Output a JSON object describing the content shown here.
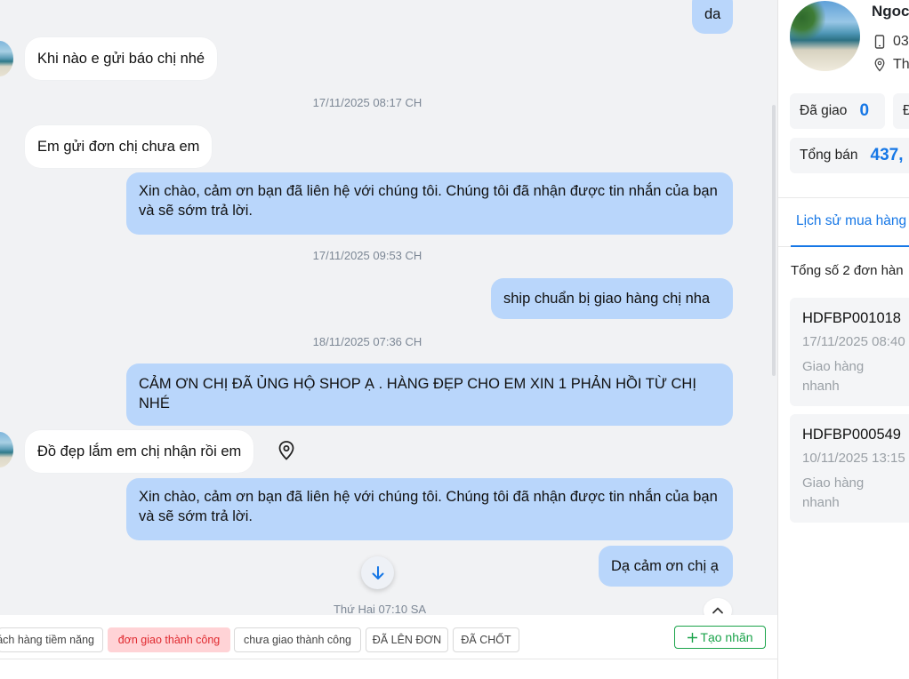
{
  "chat": {
    "messages": [
      {
        "text": "da"
      },
      {
        "text": "Khi nào e gửi báo chị nhé"
      },
      {
        "text": "17/11/2025 08:17 CH"
      },
      {
        "text": "Em gửi đơn chị chưa em"
      },
      {
        "text": "Xin chào, cảm ơn bạn đã liên hệ với chúng tôi. Chúng tôi đã nhận được tin nhắn của bạn và sẽ sớm trả lời."
      },
      {
        "text": "17/11/2025 09:53 CH"
      },
      {
        "text": "ship chuẩn bị giao hàng chị nha"
      },
      {
        "text": "18/11/2025 07:36 CH"
      },
      {
        "text": "CẢM ƠN CHỊ ĐÃ ỦNG HỘ SHOP Ạ . HÀNG ĐẸP CHO EM XIN 1 PHẢN HỒI TỪ CHỊ NHÉ"
      },
      {
        "text": "Đồ đẹp lắm em chị nhận rồi em"
      },
      {
        "text": "Xin chào, cảm ơn bạn đã liên hệ với chúng tôi. Chúng tôi đã nhận được tin nhắn của bạn và sẽ sớm trả lời."
      },
      {
        "text": "Dạ cảm ơn chị ạ"
      },
      {
        "text": "Thứ Hai 07:10 SA"
      }
    ]
  },
  "tags": {
    "items": [
      {
        "label": "ách hàng tiềm năng"
      },
      {
        "label": "đơn giao thành công",
        "color": "#e0292f"
      },
      {
        "label": "chưa giao thành công"
      },
      {
        "label": "ĐÃ LÊN ĐƠN"
      },
      {
        "label": "ĐÃ CHỐT"
      }
    ],
    "create_label": "Tạo nhãn",
    "create_color": "#1aa34a"
  },
  "customer": {
    "name": "Ngoc",
    "phone": "03",
    "address": "Th",
    "stats": {
      "delivered_label": "Đã giao",
      "delivered_value": "0",
      "next_label": "Đ",
      "total_label": "Tổng bán",
      "total_value": "437,"
    }
  },
  "history": {
    "tab_label": "Lịch sử mua hàng",
    "count_prefix": "Tổng số ",
    "count_value": "2",
    "count_suffix": " đơn hàn",
    "orders": [
      {
        "code": "HDFBP001018",
        "date": "17/11/2025 08:40",
        "ship": "Giao hàng nhanh"
      },
      {
        "code": "HDFBP000549",
        "date": "10/11/2025 13:15",
        "ship": "Giao hàng nhanh"
      }
    ]
  },
  "colors": {
    "accent": "#1677e6",
    "bubble_out": "#b9d6fb",
    "chat_bg": "#f1f2f4"
  }
}
